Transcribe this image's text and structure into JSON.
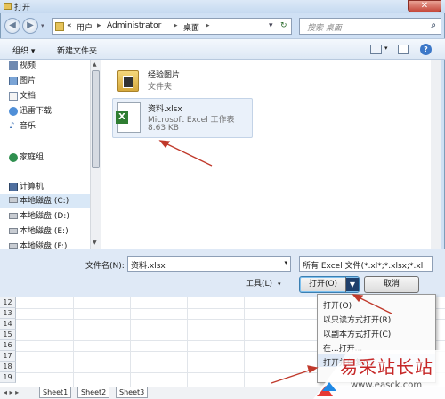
{
  "window": {
    "title": "打开",
    "close_glyph": "✕"
  },
  "address": {
    "parts": [
      "«",
      "用户",
      "▸",
      "Administrator",
      "▸",
      "桌面",
      "▸"
    ],
    "search_placeholder": "搜索 桌面"
  },
  "toolbar": {
    "organize": "组织 ▾",
    "new_folder": "新建文件夹"
  },
  "nav": [
    {
      "label": "视频",
      "icon": "video-icon"
    },
    {
      "label": "图片",
      "icon": "picture-icon"
    },
    {
      "label": "文档",
      "icon": "document-icon"
    },
    {
      "label": "迅雷下载",
      "icon": "download-icon"
    },
    {
      "label": "音乐",
      "icon": "music-icon"
    },
    {
      "label": "家庭组",
      "icon": "homegroup-icon"
    },
    {
      "label": "计算机",
      "icon": "computer-icon"
    },
    {
      "label": "本地磁盘 (C:)",
      "icon": "drive-icon"
    },
    {
      "label": "本地磁盘 (D:)",
      "icon": "drive-icon"
    },
    {
      "label": "本地磁盘 (E:)",
      "icon": "drive-icon"
    },
    {
      "label": "本地磁盘 (F:)",
      "icon": "drive-icon"
    }
  ],
  "files": [
    {
      "name": "经验图片",
      "type": "文件夹",
      "icon": "folder-icon"
    },
    {
      "name": "资料.xlsx",
      "type": "Microsoft Excel 工作表",
      "size": "8.63 KB",
      "icon": "excel-file-icon"
    }
  ],
  "bottom": {
    "filename_label": "文件名(N):",
    "filename_value": "资料.xlsx",
    "filetype_value": "所有 Excel 文件(*.xl*;*.xlsx;*.xl",
    "tools": "工具(L)",
    "open": "打开(O)",
    "cancel": "取消"
  },
  "open_menu": [
    "打开(O)",
    "以只读方式打开(R)",
    "以副本方式打开(C)",
    "在...打开...",
    "打开并修复(E)"
  ],
  "excel": {
    "rows": [
      "12",
      "13",
      "14",
      "15",
      "16",
      "17",
      "18",
      "19"
    ],
    "sheets": [
      "Sheet1",
      "Sheet2",
      "Sheet3"
    ]
  },
  "watermark": {
    "text": "易采站长站",
    "url": "www.easck.com"
  },
  "colors": {
    "arrow": "#c0392b",
    "selection": "#d9e8f7"
  }
}
